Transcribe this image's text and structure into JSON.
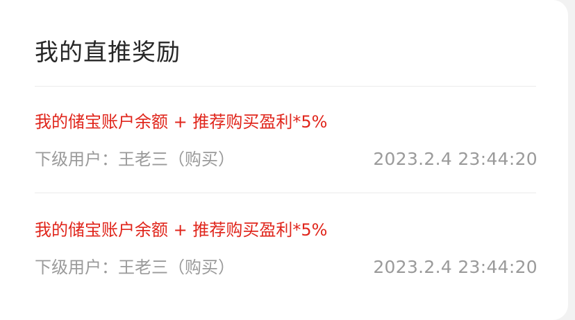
{
  "card": {
    "title": "我的直推奖励"
  },
  "records": [
    {
      "description": "我的储宝账户余额 + 推荐购买盈利*5%",
      "sub_user": "下级用户：王老三（购买）",
      "timestamp": "2023.2.4 23:44:20"
    },
    {
      "description": "我的储宝账户余额 + 推荐购买盈利*5%",
      "sub_user": "下级用户：王老三（购买）",
      "timestamp": "2023.2.4 23:44:20"
    }
  ],
  "colors": {
    "accent_red": "#e0261c",
    "muted_gray": "#9a9a9a",
    "title_dark": "#262626",
    "card_bg": "#ffffff",
    "page_bg": "#f2f2f2"
  }
}
